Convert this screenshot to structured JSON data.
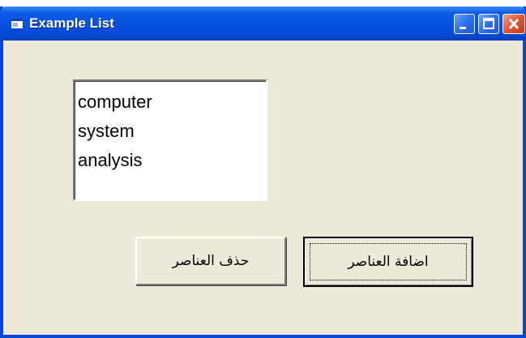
{
  "window": {
    "title": "Example List",
    "icon": "app-window-icon"
  },
  "titlebar_buttons": {
    "minimize": "minimize-icon",
    "maximize": "maximize-icon",
    "close": "close-icon"
  },
  "listbox": {
    "items": [
      "computer",
      "system",
      "analysis"
    ]
  },
  "buttons": {
    "delete_label": "حذف العناصر",
    "add_label": "اضافة العناصر"
  },
  "colors": {
    "titlebar": "#0650e0",
    "window_bg": "#ece9d8",
    "close_button": "#e2552f"
  }
}
